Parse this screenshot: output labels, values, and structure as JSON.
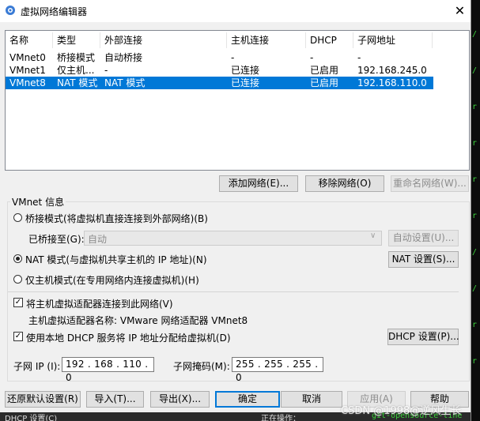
{
  "window": {
    "title": "虚拟网络编辑器",
    "close": "✕"
  },
  "list": {
    "columns": [
      "名称",
      "类型",
      "外部连接",
      "主机连接",
      "DHCP",
      "子网地址"
    ],
    "rows": [
      [
        "VMnet0",
        "桥接模式",
        "自动桥接",
        "-",
        "-",
        "-"
      ],
      [
        "VMnet1",
        "仅主机...",
        "-",
        "已连接",
        "已启用",
        "192.168.245.0"
      ],
      [
        "VMnet8",
        "NAT 模式",
        "NAT 模式",
        "已连接",
        "已启用",
        "192.168.110.0"
      ]
    ],
    "selected_index": 2
  },
  "list_buttons": {
    "add": "添加网络(E)...",
    "remove": "移除网络(O)",
    "rename": "重命名网络(W)..."
  },
  "vmnet_info": {
    "group_title": "VMnet 信息",
    "bridge_label": "桥接模式(将虚拟机直接连接到外部网络)(B)",
    "bridged_to_label": "已桥接至(G):",
    "bridged_to_value": "自动",
    "auto_settings": "自动设置(U)...",
    "nat_label": "NAT 模式(与虚拟机共享主机的 IP 地址)(N)",
    "nat_settings": "NAT 设置(S)...",
    "hostonly_label": "仅主机模式(在专用网络内连接虚拟机)(H)",
    "connect_adapter_label": "将主机虚拟适配器连接到此网络(V)",
    "adapter_name_text": "主机虚拟适配器名称: VMware 网络适配器 VMnet8",
    "use_dhcp_label": "使用本地 DHCP 服务将 IP 地址分配给虚拟机(D)",
    "dhcp_settings": "DHCP 设置(P)...",
    "subnet_ip_label": "子网 IP (I):",
    "subnet_ip_value": "192 . 168 . 110 . 0",
    "subnet_mask_label": "子网掩码(M):",
    "subnet_mask_value": "255 . 255 . 255 . 0",
    "selected_mode": "nat",
    "connect_adapter_checked": true,
    "use_dhcp_checked": true
  },
  "footer_buttons": {
    "restore": "还原默认设置(R)",
    "import": "导入(T)...",
    "export": "导出(X)...",
    "ok": "确定",
    "cancel": "取消",
    "apply": "应用(A)",
    "help": "帮助"
  },
  "background": {
    "bottom_left": "DHCP 设置(C)",
    "bottom_mid": "正在操作：",
    "bottom_right": "git-opensource-line",
    "watermark": "CSDN @1998@逆风生长"
  },
  "colors": {
    "selection": "#0078d7",
    "default_button_border": "#0078d7",
    "terminal_green": "#3ad13a"
  },
  "icons": {
    "title": "network-editor-icon",
    "dropdown": "chevron-down-icon"
  }
}
